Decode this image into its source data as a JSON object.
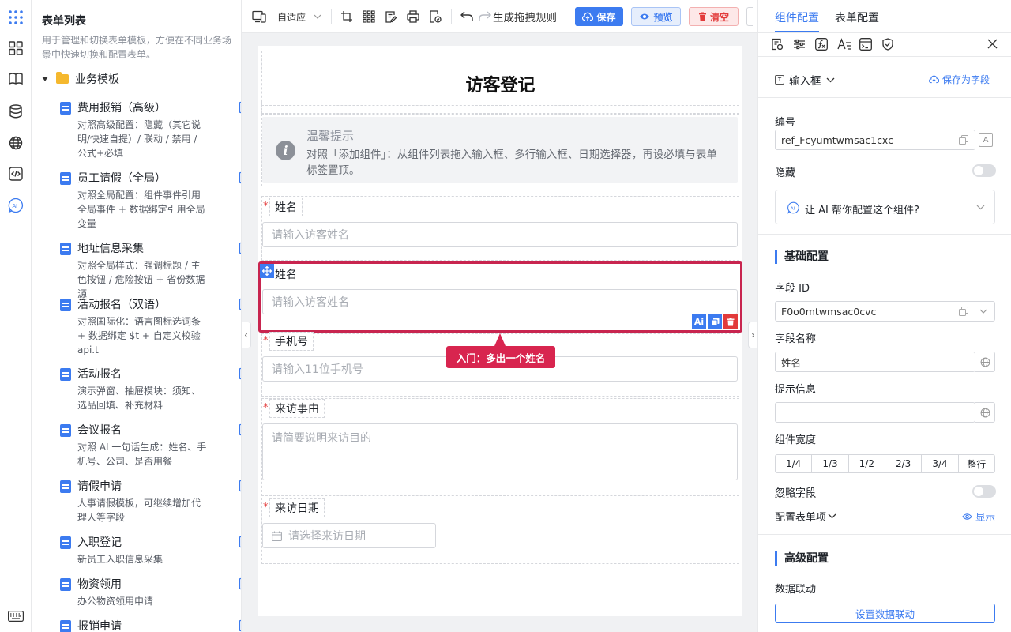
{
  "rail": {
    "icons": [
      "apps-icon",
      "widgets-icon",
      "book-icon",
      "database-icon",
      "globe-icon",
      "code-icon",
      "ai-icon",
      "keyboard-icon"
    ]
  },
  "templates": {
    "title": "表单列表",
    "description": "用于管理和切换表单模板，方便在不同业务场景中快速切换和配置表单。",
    "group": "业务模板",
    "items": [
      {
        "name": "费用报销（高级）",
        "desc": "对照高级配置：隐藏（其它说明/快速自提）/ 联动 / 禁用 / 公式+必填"
      },
      {
        "name": "员工请假（全局）",
        "desc": "对照全局配置：组件事件引用全局事件 + 数据绑定引用全局变量"
      },
      {
        "name": "地址信息采集",
        "desc": "对照全局样式：强调标题 / 主色按钮 / 危险按钮 + 省份数据源"
      },
      {
        "name": "活动报名（双语）",
        "desc": "对照国际化：语言图标选词条 + 数据绑定 $t + 自定义校验 api.t"
      },
      {
        "name": "活动报名",
        "desc": "演示弹窗、抽屉模块：须知、选品回填、补充材料"
      },
      {
        "name": "会议报名",
        "desc": "对照 AI 一句话生成：姓名、手机号、公司、是否用餐"
      },
      {
        "name": "请假申请",
        "desc": "人事请假模板，可继续增加代理人等字段"
      },
      {
        "name": "入职登记",
        "desc": "新员工入职信息采集"
      },
      {
        "name": "物资领用",
        "desc": "办公物资领用申请"
      },
      {
        "name": "报销申请",
        "desc": ""
      }
    ]
  },
  "toolbar": {
    "adapt": "自适应",
    "rules": "生成拖拽规则",
    "save": "保存",
    "preview": "预览",
    "clear": "清空"
  },
  "form": {
    "title": "访客登记",
    "tip_title": "温馨提示",
    "tip_text": "对照「添加组件」：从组件列表拖入输入框、多行输入框、日期选择器，再设必填与表单标签置顶。",
    "fields": [
      {
        "label": "姓名",
        "placeholder": "请输入访客姓名",
        "required": true
      },
      {
        "label": "姓名",
        "placeholder": "请输入访客姓名",
        "required": false
      },
      {
        "label": "手机号",
        "placeholder": "请输入11位手机号",
        "required": true
      },
      {
        "label": "来访事由",
        "placeholder": "请简要说明来访目的",
        "required": true
      },
      {
        "label": "来访日期",
        "placeholder": "请选择来访日期",
        "required": true
      }
    ],
    "callout": "入门：多出一个姓名",
    "action_ai": "Ai"
  },
  "right_panel": {
    "tabs": [
      "组件配置",
      "表单配置"
    ],
    "component_type": "输入框",
    "save_as_field": "保存为字段",
    "ref_label": "编号",
    "ref_value": "ref_Fcyumtwmsac1cxc",
    "hidden_label": "隐藏",
    "ai_prompt": "让 AI 帮你配置这个组件?",
    "basic_section": "基础配置",
    "field_id_label": "字段 ID",
    "field_id_value": "F0o0mtwmsac0cvc",
    "field_name_label": "字段名称",
    "field_name_value": "姓名",
    "hint_label": "提示信息",
    "hint_value": "",
    "width_label": "组件宽度",
    "widths": [
      "1/4",
      "1/3",
      "1/2",
      "2/3",
      "3/4",
      "整行"
    ],
    "ignore_label": "忽略字段",
    "config_items_label": "配置表单项",
    "show_label": "显示",
    "advanced_section": "高级配置",
    "linkage_label": "数据联动",
    "linkage_button": "设置数据联动"
  },
  "colors": {
    "primary": "#3c7bf0",
    "danger": "#e23a3a",
    "selected_border": "#c8254f",
    "callout": "#d8254f"
  }
}
